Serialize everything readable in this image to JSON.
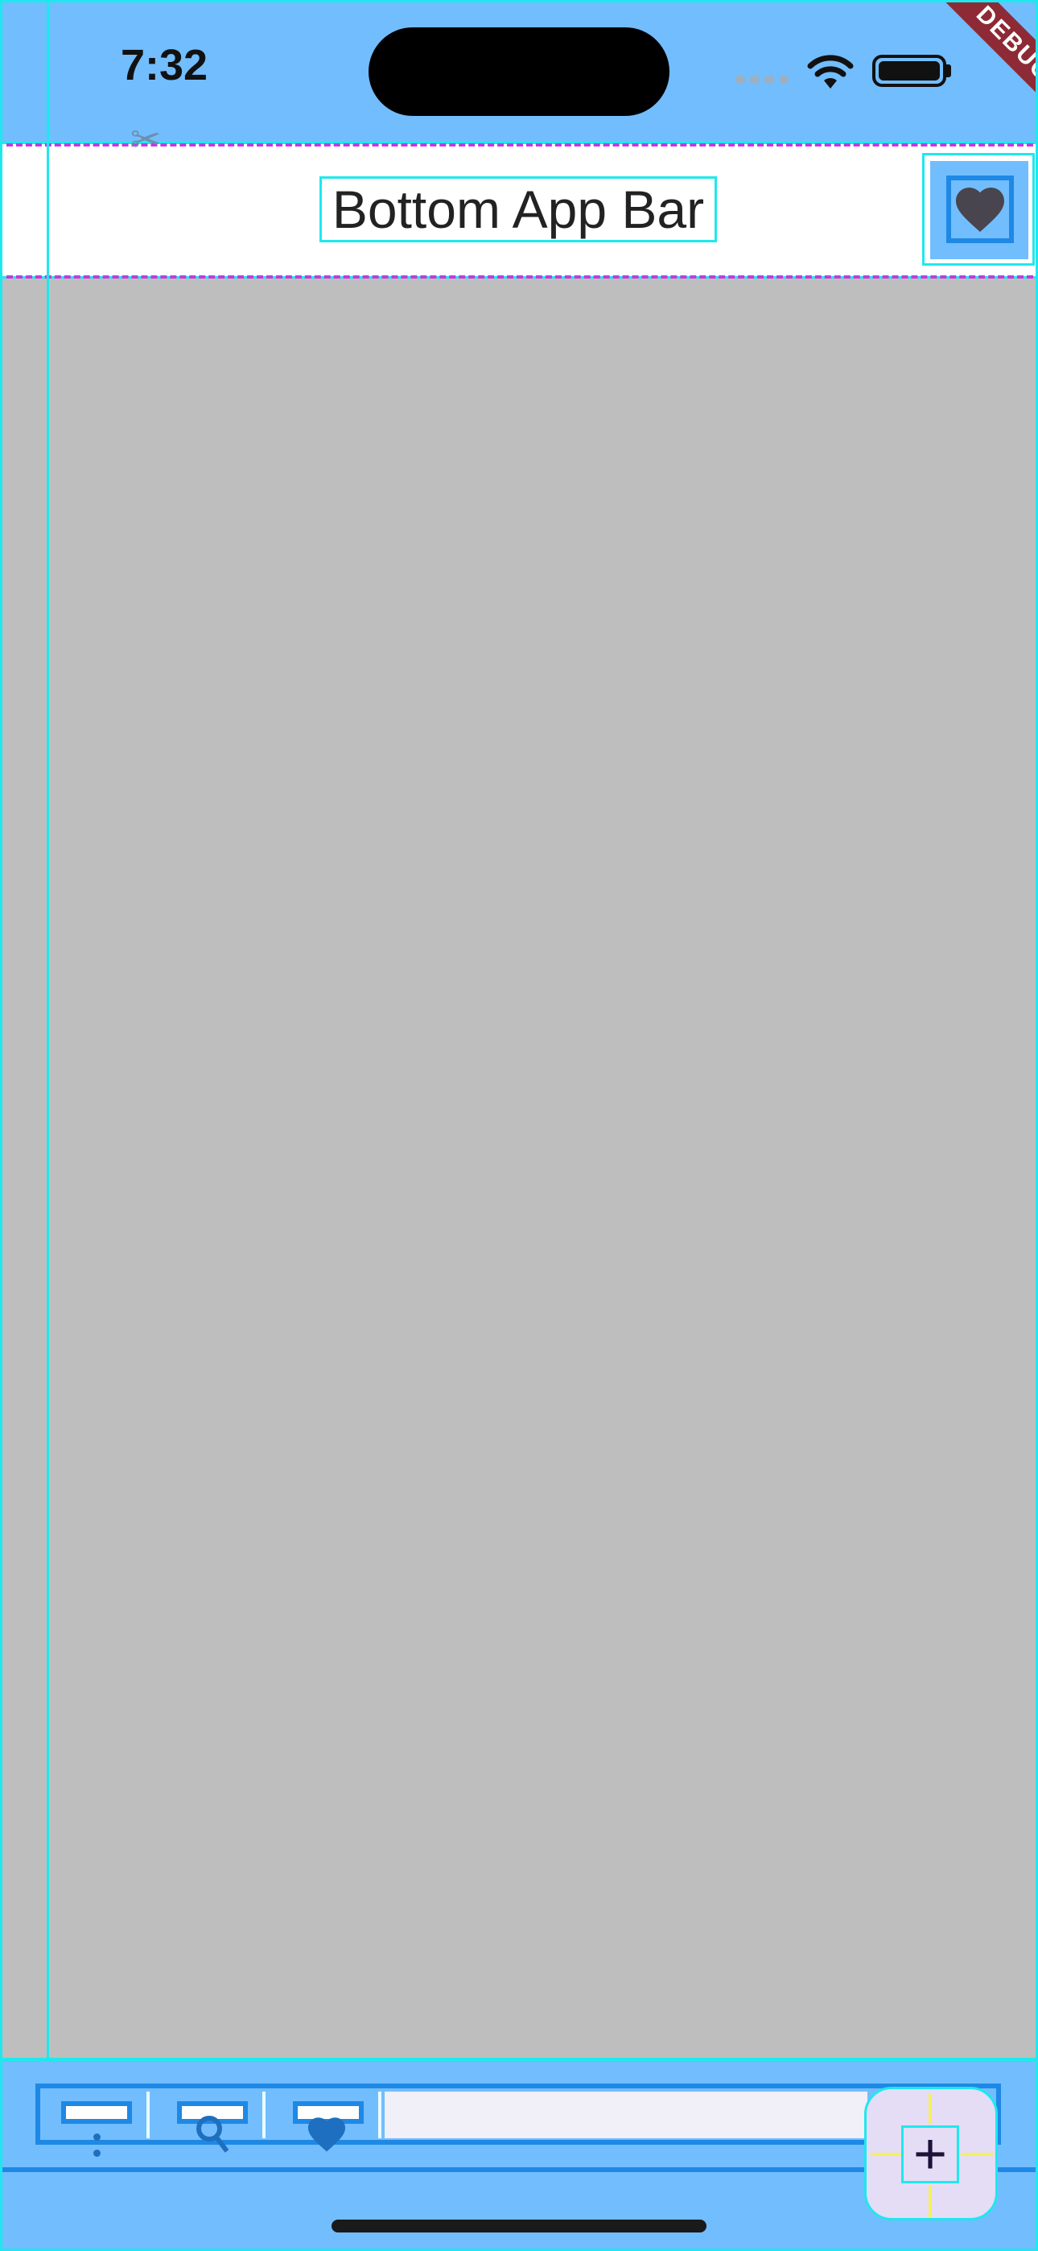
{
  "status_bar": {
    "time": "7:32",
    "icons": [
      "wifi-icon",
      "battery-icon"
    ],
    "debug_label": "DEBUG"
  },
  "app_bar": {
    "title": "Bottom App Bar",
    "action_icon": "heart-icon"
  },
  "bottom_bar": {
    "items": [
      {
        "icon": "more-vert-icon"
      },
      {
        "icon": "search-icon"
      },
      {
        "icon": "heart-icon"
      }
    ]
  },
  "fab": {
    "label": "+",
    "icon": "plus-icon"
  },
  "colors": {
    "status_bar_bg": "#72bdfd",
    "body_bg": "#bfbebf",
    "app_bar_bg": "#ffffff",
    "guide_cyan": "#1ee8ee",
    "accent_blue": "#1e88e5",
    "fab_bg": "#e5dcf6",
    "debug_banner": "#8e2a35"
  }
}
